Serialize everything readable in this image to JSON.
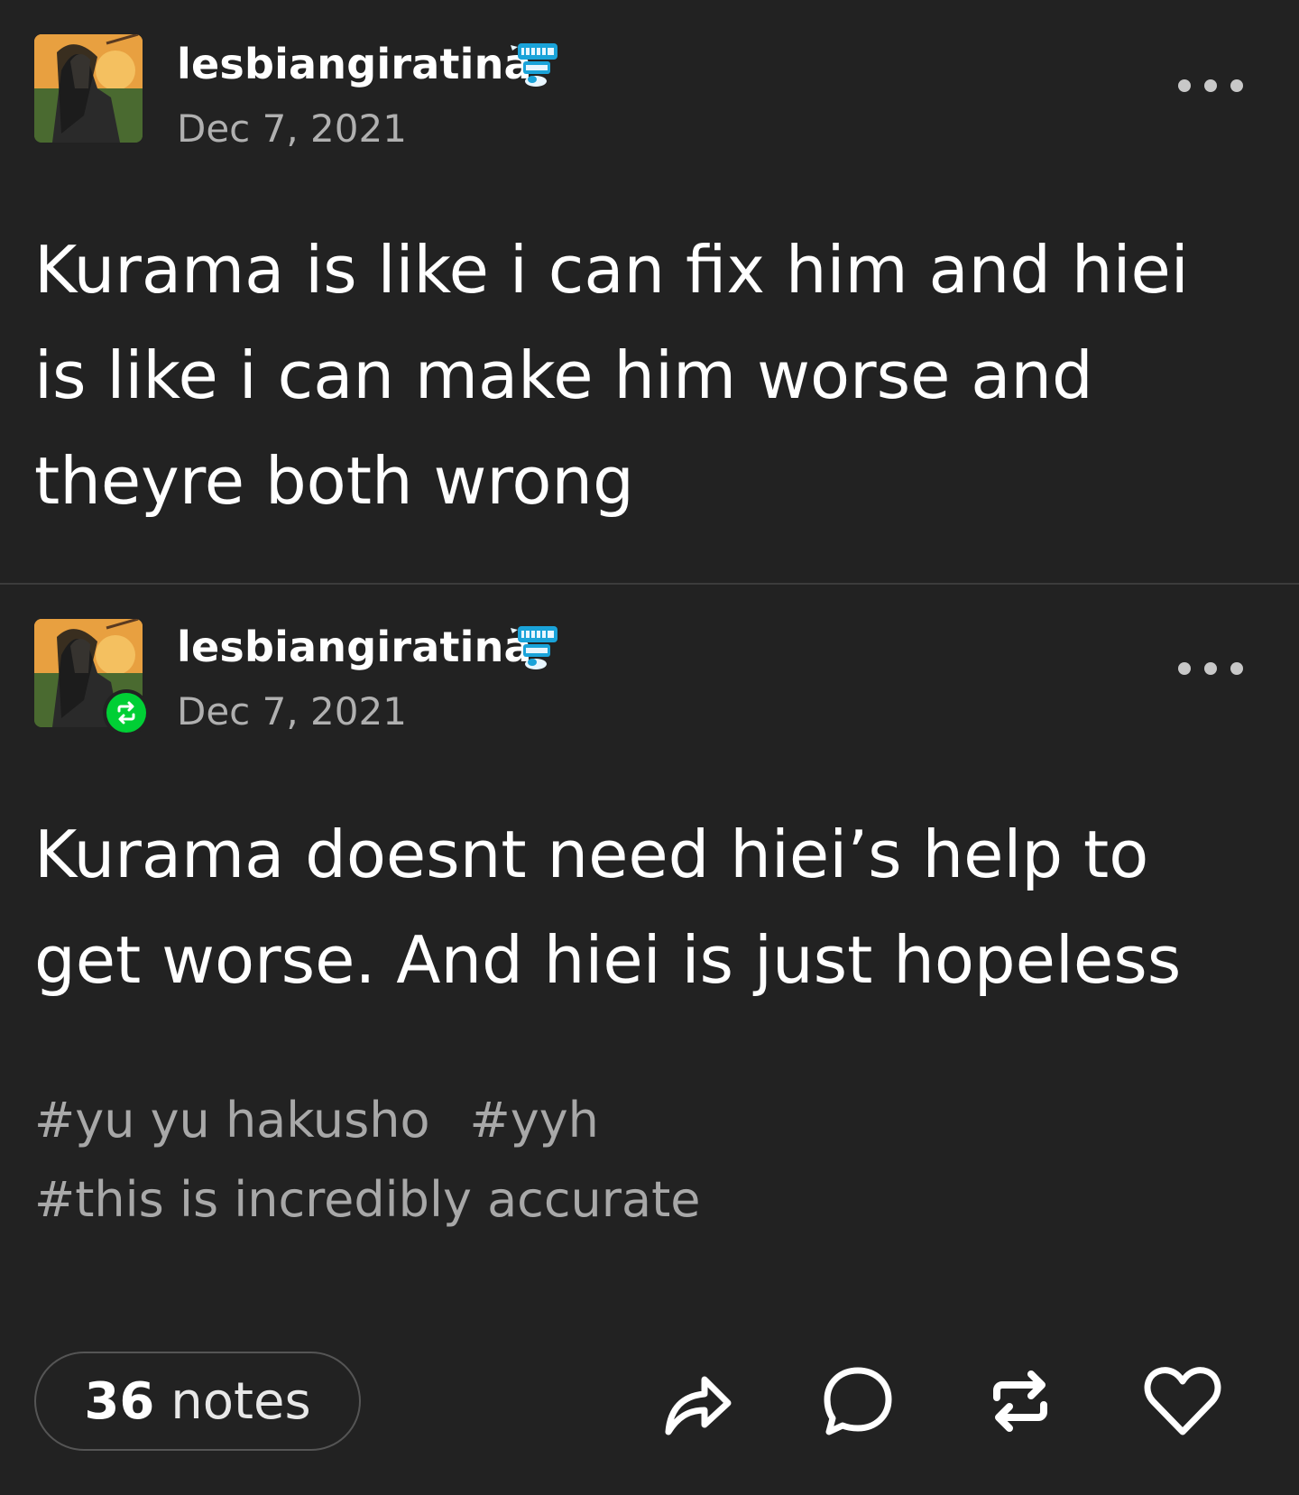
{
  "posts": [
    {
      "username": "lesbiangiratina",
      "date": "Dec 7, 2021",
      "text": "Kurama is like i can fix him and hiei is like i can make him worse and theyre both wrong",
      "avatar_icon": "avatar-image",
      "badge_icon": "teeth-badge-icon",
      "more_icon": "more-dots-icon"
    },
    {
      "username": "lesbiangiratina",
      "date": "Dec 7, 2021",
      "text": "Kurama doesnt need hiei’s help to get worse. And hiei is just hopeless",
      "avatar_icon": "avatar-image",
      "reblog_icon": "reblog-icon",
      "badge_icon": "teeth-badge-icon",
      "more_icon": "more-dots-icon"
    }
  ],
  "tags": [
    "#yu yu hakusho",
    "#yyh",
    "#this is incredibly accurate"
  ],
  "footer": {
    "notes_count": "36",
    "notes_label": "notes",
    "actions": [
      "share-icon",
      "reply-icon",
      "reblog-icon",
      "like-icon"
    ]
  },
  "colors": {
    "background": "#222222",
    "text": "#ffffff",
    "muted": "#b0b0b0",
    "reblog_green": "#00cf35",
    "badge_blue": "#1aa3d9"
  }
}
